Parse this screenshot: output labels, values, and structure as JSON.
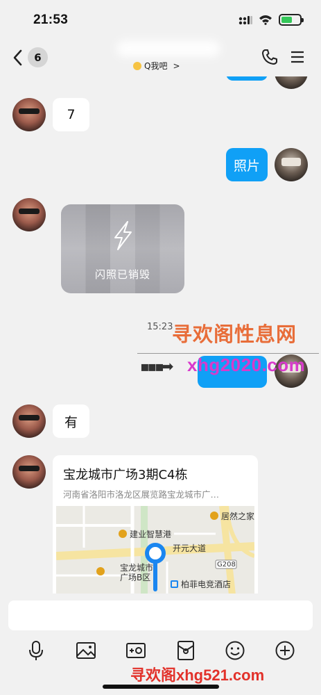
{
  "status_bar": {
    "time": "21:53"
  },
  "header": {
    "unread_count": "6",
    "subtitle": "Q我吧",
    "subtitle_chevron": ">"
  },
  "messages": {
    "m1_text": "7",
    "m2_text": "照片",
    "flash_photo_label": "闪照已销毁",
    "timestamp": "15:23",
    "m4_text": "有",
    "location": {
      "title": "宝龙城市广场3期C4栋",
      "address": "河南省洛阳市洛龙区展览路宝龙城市广…",
      "map_labels": {
        "poi1": "建业智慧港",
        "poi2": "居然之家",
        "road1": "开元大道",
        "poi3_line1": "宝龙城市",
        "poi3_line2": "广场B区",
        "poi4": "柏菲电竞酒店",
        "road_badge": "G208"
      }
    }
  },
  "watermarks": {
    "w1": "寻欢阁性息网",
    "w2": "xhg2020.com",
    "w3": "寻欢阁xhg521.com"
  },
  "input": {
    "placeholder": ""
  },
  "colors": {
    "accent_blue": "#10a0f6",
    "background": "#f1f1f1"
  }
}
